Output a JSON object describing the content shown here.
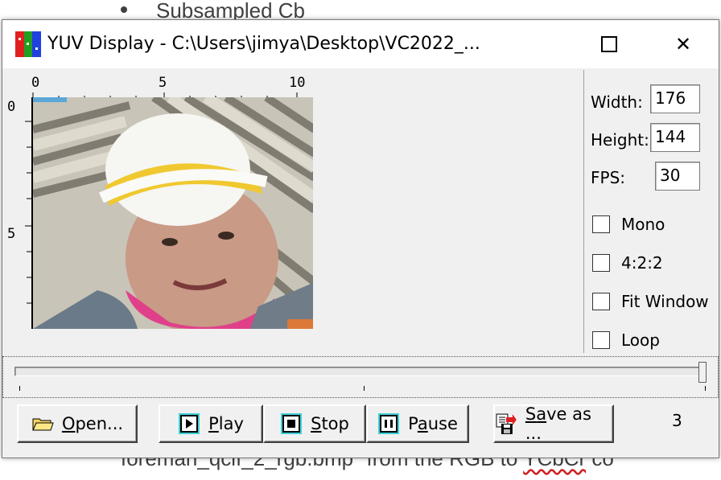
{
  "background": {
    "doc_text_top": "Subsampled Cb",
    "doc_text_bottom_a": "foreman_qcif_2_rgb.bmp\" from the RGB to ",
    "doc_text_bottom_b": "YCbCr",
    "doc_text_bottom_c": " co"
  },
  "window": {
    "title": "YUV Display - C:\\Users\\jimya\\Desktop\\VC2022_...",
    "app_icon": "yuv-app-icon",
    "maximize_icon": "maximize-icon",
    "close_glyph": "✕"
  },
  "rulers": {
    "h": [
      "0",
      "5",
      "10"
    ],
    "v": [
      "0",
      "5"
    ]
  },
  "panel": {
    "width_label": "Width:",
    "width_value": "176",
    "height_label": "Height:",
    "height_value": "144",
    "fps_label": "FPS:",
    "fps_value": "30",
    "checkboxes": [
      {
        "label": "Mono",
        "checked": false
      },
      {
        "label": "4:2:2",
        "checked": false
      },
      {
        "label": "Fit Window",
        "checked": false
      },
      {
        "label": "Loop",
        "checked": false
      }
    ]
  },
  "slider": {
    "position": 1.0
  },
  "buttons": {
    "open": {
      "first": "O",
      "rest": "pen...",
      "icon": "folder-icon"
    },
    "play": {
      "first": "P",
      "rest": "lay",
      "icon": "play-icon"
    },
    "stop": {
      "first": "S",
      "rest": "top",
      "icon": "stop-icon"
    },
    "pause": {
      "pre": "P",
      "ul": "a",
      "rest": "use",
      "icon": "pause-icon"
    },
    "save": {
      "first": "S",
      "ul": "a",
      "rest": "ve as ...",
      "icon": "save-icon"
    }
  },
  "frame_counter": "3"
}
